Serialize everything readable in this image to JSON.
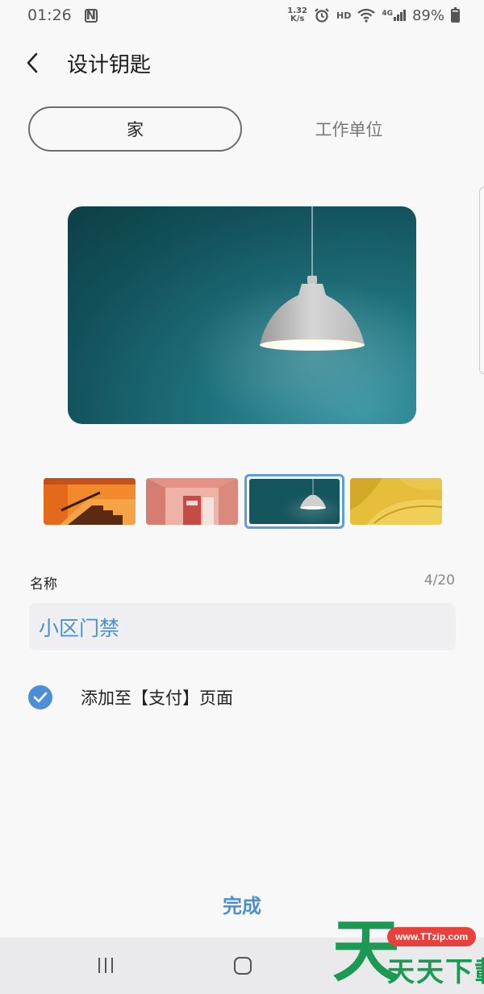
{
  "status_bar": {
    "time": "01:26",
    "nfc_icon": "N",
    "speed_value": "1.32",
    "speed_unit": "K/s",
    "hd": "HD",
    "network": "4G",
    "battery": "89%",
    "battery_level": 0.89
  },
  "header": {
    "title": "设计钥匙",
    "back_icon": "chevron-left-icon"
  },
  "tabs": [
    {
      "label": "家",
      "active": true
    },
    {
      "label": "工作单位",
      "active": false
    }
  ],
  "preview": {
    "image": "pendant-lamp-teal-wall"
  },
  "thumbnails": [
    {
      "image": "orange-staircase",
      "selected": false
    },
    {
      "image": "pink-hallway",
      "selected": false
    },
    {
      "image": "pendant-lamp-teal-wall",
      "selected": true
    },
    {
      "image": "yellow-sofa",
      "selected": false
    }
  ],
  "name_field": {
    "label": "名称",
    "counter": "4/20",
    "value": "小区门禁"
  },
  "add_to_pay": {
    "label": "添加至【支付】页面",
    "checked": true
  },
  "done_label": "完成",
  "watermark": {
    "big_char": "天",
    "url": "www.TTzip.com",
    "text": "天天下載"
  },
  "colors": {
    "accent": "#4c8fd0",
    "background": "#f8f8f9",
    "teal": "#1d6f7a"
  }
}
